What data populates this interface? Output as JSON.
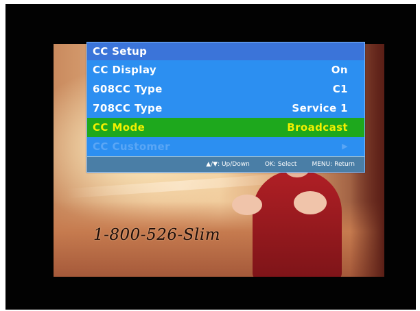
{
  "broadcast": {
    "phone_number": "1-800-526-Slim"
  },
  "menu": {
    "title": "CC Setup",
    "items": [
      {
        "label": "CC Display",
        "value": "On"
      },
      {
        "label": "608CC Type",
        "value": "C1"
      },
      {
        "label": "708CC Type",
        "value": "Service 1"
      },
      {
        "label": "CC Mode",
        "value": "Broadcast"
      },
      {
        "label": "CC Customer",
        "value": ""
      }
    ],
    "selected_index": 3,
    "footer": {
      "navigate": "▲/▼: Up/Down",
      "select": "OK: Select",
      "return": "MENU: Return"
    }
  },
  "colors": {
    "menu_background": "#2c8ff1",
    "menu_title_background": "#3b74d9",
    "selected_row_background": "#1ea81d",
    "selected_text": "#f3f000",
    "footer_background": "#4a7ea6"
  }
}
